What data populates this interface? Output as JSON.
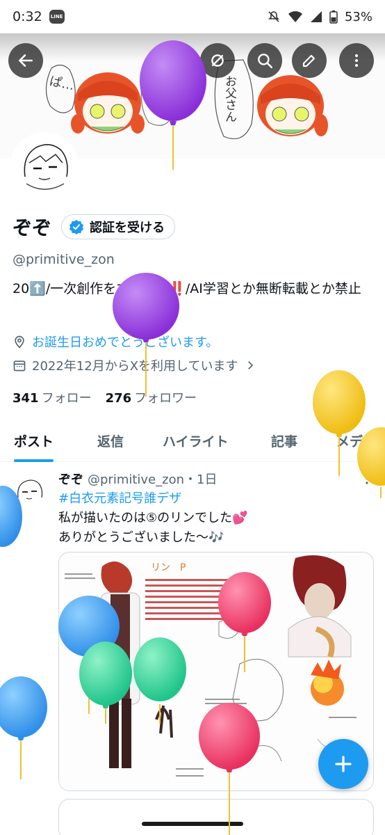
{
  "status_bar": {
    "time": "0:32",
    "app_badge": "LINE",
    "battery": "53%"
  },
  "header": {
    "back_icon": "arrow-left-icon",
    "grok_icon": "grok-icon",
    "search_icon": "search-icon",
    "edit_icon": "edit-icon",
    "more_icon": "more-vertical-icon"
  },
  "banner": {
    "text_left": "ぱ…",
    "text_mid": "ぱ…",
    "text_right": "お父さん"
  },
  "profile": {
    "display_name": "ぞぞ",
    "verify_label": "認証を受ける",
    "handle": "@primitive_zon",
    "bio": "20⬆️/一次創作をするぞ～‼️/AI学習とか無断転載とか禁止",
    "link_text": "お誕生日おめでとうございます。",
    "joined": "2022年12月からXを利用しています",
    "following_count": "341",
    "following_label": "フォロー",
    "followers_count": "276",
    "followers_label": "フォロワー"
  },
  "tabs": [
    "ポスト",
    "返信",
    "ハイライト",
    "記事",
    "メディア"
  ],
  "active_tab": "ポスト",
  "post": {
    "name": "ぞぞ",
    "handle_time": "@primitive_zon・1日",
    "hashtag": "#白衣元素記号誰デザ",
    "line1": "私が描いたのは⑤のリンでした💕",
    "line2": "ありがとうございました～🎶",
    "media_title": "リン　P"
  },
  "fab_icon": "plus-icon",
  "colors": {
    "accent": "#1d9bf0",
    "balloon_purple": "#9b45e0",
    "balloon_yellow": "#f2c51c",
    "balloon_blue": "#3a9cf0",
    "balloon_green": "#2fd29a",
    "balloon_pink": "#f0406e"
  }
}
